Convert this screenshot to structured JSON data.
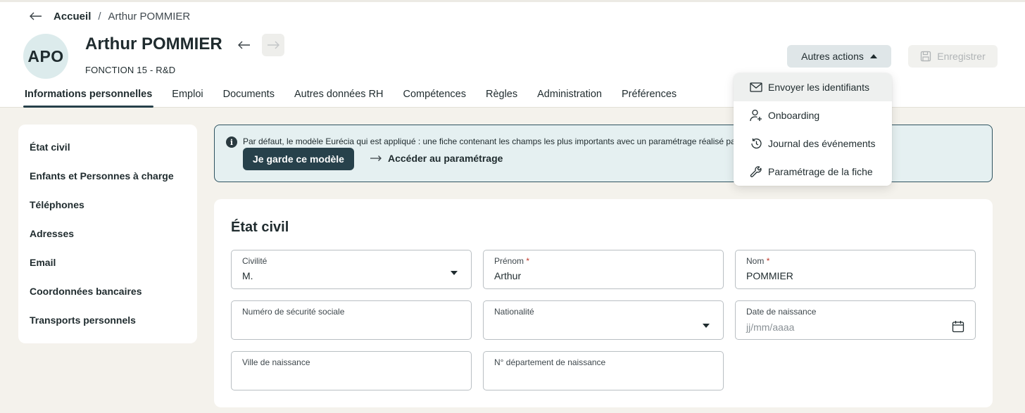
{
  "breadcrumb": {
    "home": "Accueil",
    "separator": "/",
    "current": "Arthur POMMIER"
  },
  "person": {
    "initials": "APO",
    "name": "Arthur POMMIER",
    "role": "FONCTION 15 - R&D"
  },
  "tabs": [
    {
      "label": "Informations personnelles",
      "active": true
    },
    {
      "label": "Emploi"
    },
    {
      "label": "Documents"
    },
    {
      "label": "Autres données RH"
    },
    {
      "label": "Compétences"
    },
    {
      "label": "Règles"
    },
    {
      "label": "Administration"
    },
    {
      "label": "Préférences"
    }
  ],
  "toolbar": {
    "other_actions": "Autres actions",
    "save": "Enregistrer"
  },
  "dropdown": {
    "items": [
      {
        "label": "Envoyer les identifiants",
        "icon": "envelope-icon"
      },
      {
        "label": "Onboarding",
        "icon": "user-plus-icon"
      },
      {
        "label": "Journal des événements",
        "icon": "history-icon"
      },
      {
        "label": "Paramétrage de la fiche",
        "icon": "wrench-icon"
      }
    ]
  },
  "sidebar": {
    "items": [
      {
        "label": "État civil"
      },
      {
        "label": "Enfants et Personnes à charge"
      },
      {
        "label": "Téléphones"
      },
      {
        "label": "Adresses"
      },
      {
        "label": "Email"
      },
      {
        "label": "Coordonnées bancaires"
      },
      {
        "label": "Transports personnels"
      }
    ]
  },
  "banner": {
    "text": "Par défaut, le modèle Eurécia qui est appliqué : une fiche contenant les champs les plus importants avec un paramétrage réalisé par",
    "keep_button": "Je garde ce modèle",
    "settings_link": "Accéder au paramétrage"
  },
  "form": {
    "title": "État civil",
    "civilite": {
      "label": "Civilité",
      "value": "M."
    },
    "prenom": {
      "label": "Prénom",
      "required": "*",
      "value": "Arthur"
    },
    "nom": {
      "label": "Nom",
      "required": "*",
      "value": "POMMIER"
    },
    "secu": {
      "label": "Numéro de sécurité sociale",
      "value": ""
    },
    "nationalite": {
      "label": "Nationalité",
      "value": ""
    },
    "naissance": {
      "label": "Date de naissance",
      "placeholder": "jj/mm/aaaa"
    },
    "ville": {
      "label": "Ville de naissance",
      "value": ""
    },
    "departement": {
      "label": "N° département de naissance",
      "value": ""
    }
  },
  "colors": {
    "primary": "#27414b",
    "banner_bg": "#e5f0f1",
    "page_bg": "#f4f2ec",
    "avatar_bg": "#dcebec"
  }
}
